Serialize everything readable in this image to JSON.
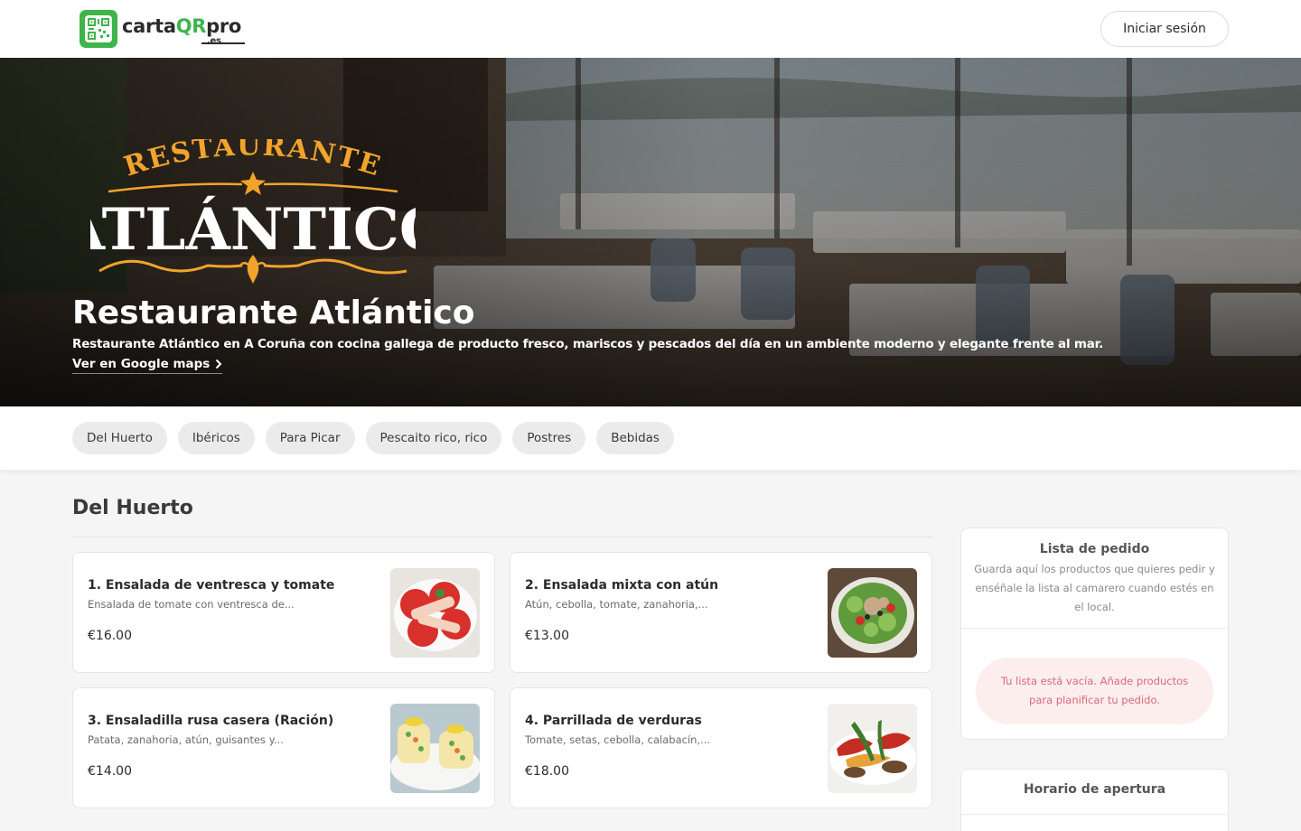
{
  "header": {
    "logo": {
      "carta": "carta",
      "qr": "QR",
      "pro": "pro",
      "tld": ".es"
    },
    "login_label": "Iniciar sesión"
  },
  "hero": {
    "logo_top": "RESTAURANTE",
    "logo_main": "ATLÁNTICO",
    "title": "Restaurante Atlántico",
    "description": "Restaurante Atlántico en A Coruña con cocina gallega de producto fresco, mariscos y pescados del día en un ambiente moderno y elegante frente al mar.",
    "maps_link": "Ver en Google maps"
  },
  "categories": [
    "Del Huerto",
    "Ibéricos",
    "Para Picar",
    "Pescaito rico, rico",
    "Postres",
    "Bebidas"
  ],
  "section": {
    "title": "Del Huerto",
    "items": [
      {
        "name": "1. Ensalada de ventresca y tomate",
        "description": "Ensalada de tomate con ventresca de...",
        "price": "€16.00",
        "image_icon": "tomato-salad-image"
      },
      {
        "name": "2. Ensalada mixta con atún",
        "description": "Atún, cebolla, tomate, zanahoria,...",
        "price": "€13.00",
        "image_icon": "mixed-salad-image"
      },
      {
        "name": "3. Ensaladilla rusa casera (Ración)",
        "description": "Patata, zanahoria, atún, guisantes y...",
        "price": "€14.00",
        "image_icon": "russian-salad-image"
      },
      {
        "name": "4. Parrillada de verduras",
        "description": "Tomate, setas, cebolla, calabacín,...",
        "price": "€18.00",
        "image_icon": "grilled-vegetables-image"
      }
    ]
  },
  "order_list": {
    "title": "Lista de pedido",
    "text": "Guarda aquí los productos que quieres pedir y enséñale la lista al camarero cuando estés en el local.",
    "empty": "Tu lista está vacía. Añade productos para planificar tu pedido."
  },
  "opening_hours": {
    "title": "Horario de apertura"
  },
  "colors": {
    "brand_green": "#3fb44b",
    "hero_gold": "#f2a42a",
    "empty_text": "#d86a7a",
    "empty_bg": "#fdeeee"
  }
}
